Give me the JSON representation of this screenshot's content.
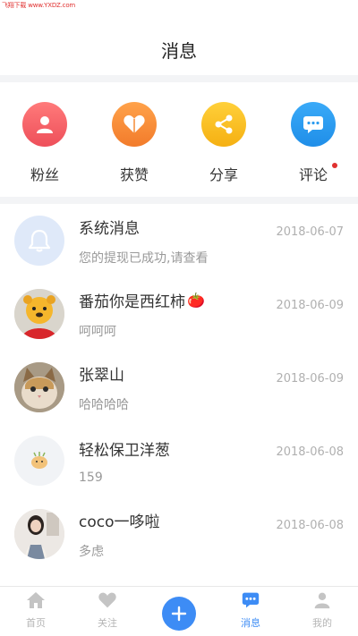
{
  "watermark": "飞翔下载 www.YXDZ.com",
  "header": {
    "title": "消息"
  },
  "quick_actions": [
    {
      "label": "粉丝",
      "icon": "person-icon",
      "color": "#f06a6a"
    },
    {
      "label": "获赞",
      "icon": "heart-icon",
      "color": "#f59a3a"
    },
    {
      "label": "分享",
      "icon": "share-icon",
      "color": "#f7c021"
    },
    {
      "label": "评论",
      "icon": "chat-icon",
      "color": "#2b9cf0",
      "unread": true
    }
  ],
  "messages": [
    {
      "name": "系统消息",
      "preview": "您的提现已成功,请查看",
      "date": "2018-06-07",
      "avatar": "bell-icon"
    },
    {
      "name": "番茄你是西红柿",
      "preview": "呵呵呵",
      "date": "2018-06-09",
      "avatar": "pooh-avatar",
      "emoji": "🍅"
    },
    {
      "name": "张翠山",
      "preview": "哈哈哈哈",
      "date": "2018-06-09",
      "avatar": "cat-avatar"
    },
    {
      "name": "轻松保卫洋葱",
      "preview": "159",
      "date": "2018-06-08",
      "avatar": "onion-avatar"
    },
    {
      "name": "coco一哆啦",
      "preview": "多虑",
      "date": "2018-06-08",
      "avatar": "girl-avatar"
    }
  ],
  "tabbar": {
    "home": "首页",
    "follow": "关注",
    "messages": "消息",
    "profile": "我的"
  },
  "colors": {
    "accent": "#3d8cf5",
    "badge": "#e0302f"
  }
}
